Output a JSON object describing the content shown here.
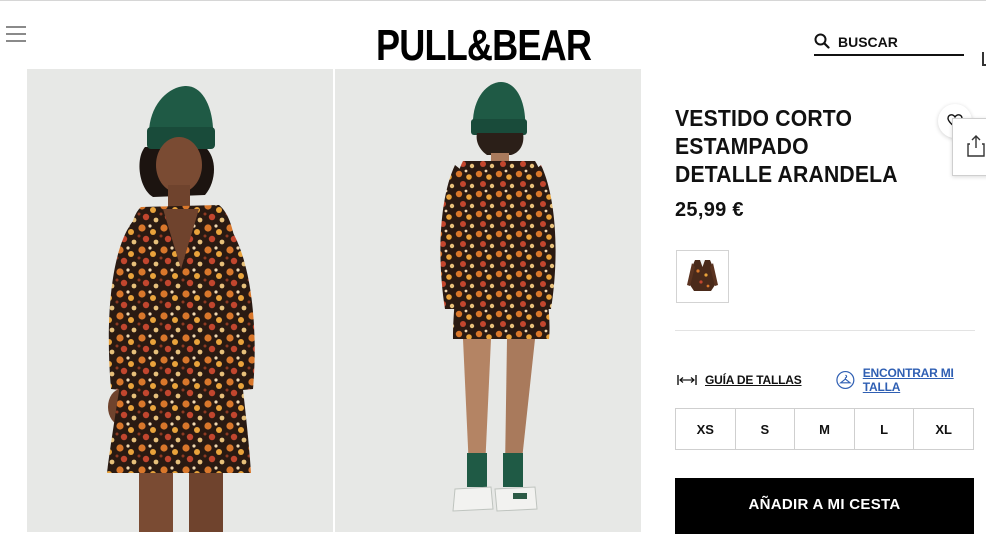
{
  "header": {
    "logo": "PULL&BEAR",
    "search_placeholder": "BUSCAR"
  },
  "product": {
    "title": "VESTIDO CORTO ESTAMPADO DETALLE ARANDELA",
    "price": "25,99 €"
  },
  "size_tools": {
    "guide_label": "GUÍA DE TALLAS",
    "find_label": "ENCONTRAR MI TALLA"
  },
  "sizes": [
    "XS",
    "S",
    "M",
    "L",
    "XL"
  ],
  "cart": {
    "add_label": "AÑADIR A MI CESTA"
  },
  "colors": {
    "background": "#ffffff",
    "photo_bg": "#e7e8e6",
    "beanie": "#1f5a45",
    "dress_base": "#2a1a12",
    "find_link": "#2f5fb3",
    "cta": "#000000"
  },
  "icons": {
    "menu": "hamburger-menu-icon",
    "search": "search-icon",
    "favorite": "heart-icon",
    "share": "share-icon",
    "guide": "ruler-icon",
    "find": "hanger-icon"
  }
}
